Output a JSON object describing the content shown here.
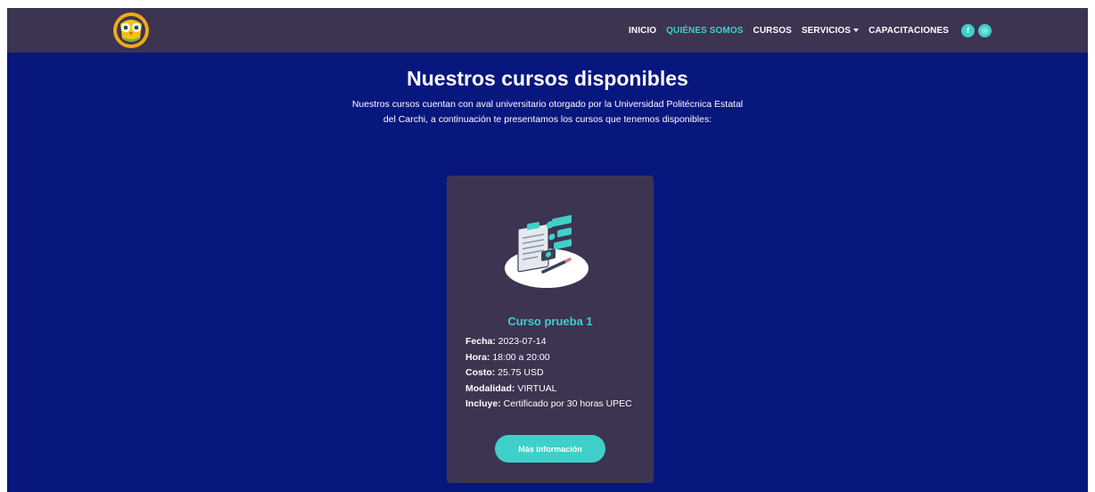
{
  "nav": {
    "items": [
      {
        "label": "INICIO",
        "active": false
      },
      {
        "label": "QUIÉNES SOMOS",
        "active": true
      },
      {
        "label": "CURSOS",
        "active": false
      },
      {
        "label": "SERVICIOS",
        "active": false,
        "dropdown": true
      },
      {
        "label": "CAPACITACIONES",
        "active": false
      }
    ],
    "social": [
      {
        "icon": "facebook-icon",
        "glyph": "f"
      },
      {
        "icon": "instagram-icon",
        "glyph": "◎"
      }
    ]
  },
  "hero": {
    "title": "Nuestros cursos disponibles",
    "description": "Nuestros cursos cuentan con aval universitario otorgado por la Universidad Politécnica Estatal del Carchi, a continuación te presentamos los cursos que tenemos disponibles:"
  },
  "course": {
    "title": "Curso prueba 1",
    "fields": [
      {
        "label": "Fecha:",
        "value": "2023-07-14"
      },
      {
        "label": "Hora:",
        "value": "18:00 a 20:00"
      },
      {
        "label": "Costo:",
        "value": "25.75 USD"
      },
      {
        "label": "Modalidad:",
        "value": "VIRTUAL"
      },
      {
        "label": "Incluye:",
        "value": "Certificado por 30 horas UPEC"
      }
    ],
    "button": "Más información"
  },
  "colors": {
    "background": "#07177e",
    "navbar": "#3c3450",
    "card": "#3c3450",
    "accent": "#3fd0c9",
    "text": "#ffffff"
  }
}
